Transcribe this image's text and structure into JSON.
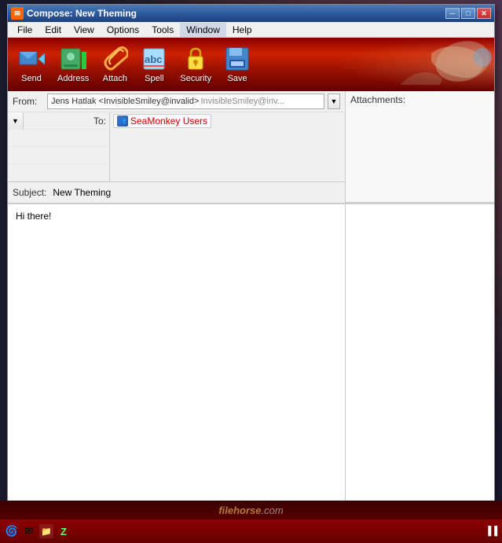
{
  "window": {
    "title": "Compose: New Theming",
    "title_icon": "✉"
  },
  "titlebar": {
    "title": "Compose: New Theming",
    "buttons": {
      "minimize": "─",
      "maximize": "□",
      "close": "✕"
    }
  },
  "menubar": {
    "items": [
      {
        "id": "file",
        "label": "File"
      },
      {
        "id": "edit",
        "label": "Edit"
      },
      {
        "id": "view",
        "label": "View"
      },
      {
        "id": "options",
        "label": "Options"
      },
      {
        "id": "tools",
        "label": "Tools"
      },
      {
        "id": "window",
        "label": "Window"
      },
      {
        "id": "help",
        "label": "Help"
      }
    ]
  },
  "toolbar": {
    "buttons": [
      {
        "id": "send",
        "label": "Send",
        "icon": "📤"
      },
      {
        "id": "address",
        "label": "Address",
        "icon": "👥"
      },
      {
        "id": "attach",
        "label": "Attach",
        "icon": "📎"
      },
      {
        "id": "spell",
        "label": "Spell",
        "icon": "abc"
      },
      {
        "id": "security",
        "label": "Security",
        "icon": "🔒"
      },
      {
        "id": "save",
        "label": "Save",
        "icon": "💾"
      }
    ]
  },
  "compose": {
    "from_label": "From:",
    "from_value": "Jens Hatlak <InvisibleSmiley@invalid>",
    "from_hint": "InvisibleSmiley@inv...",
    "to_label": "To:",
    "recipient": "SeaMonkey Users",
    "subject_label": "Subject:",
    "subject_value": "New Theming",
    "body": "Hi there!",
    "attachments_label": "Attachments:"
  },
  "taskbar": {
    "icons": [
      "🌀",
      "✉",
      "📁",
      "⚙",
      "Z"
    ],
    "right_text": "▪▪▐▐"
  },
  "filehorse": {
    "text": "filehorse",
    "domain": ".com"
  }
}
